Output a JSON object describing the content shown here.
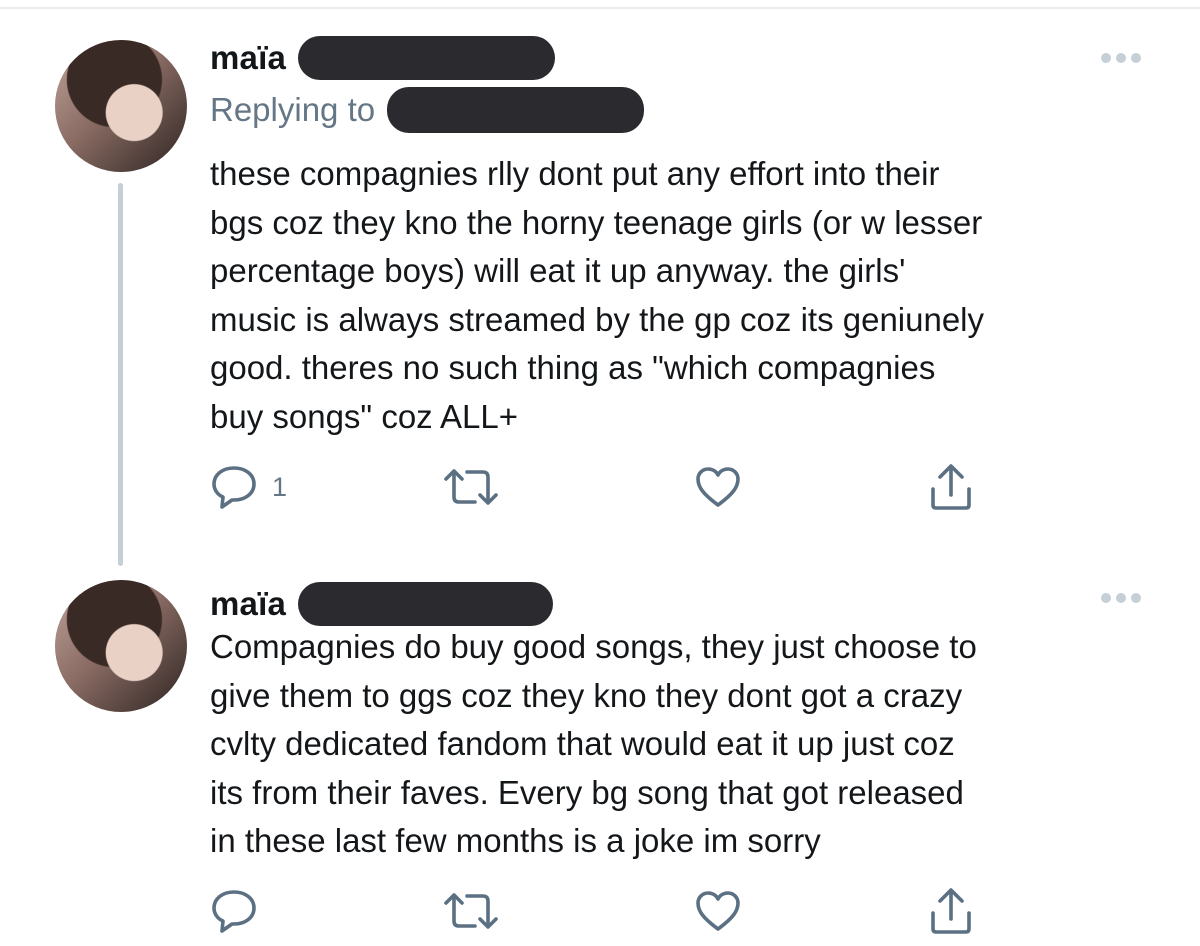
{
  "tweets": [
    {
      "display_name": "maïa",
      "handle_redacted": true,
      "replying_label": "Replying to",
      "reply_target_redacted": true,
      "text": "these compagnies rlly dont put any effort into their\nbgs coz they kno the horny teenage girls (or w lesser\npercentage boys) will eat it up anyway. the girls'\nmusic is always streamed by the gp coz its geniunely\ngood. theres no such thing as \"which compagnies\nbuy songs\" coz ALL+",
      "reply_count": "1",
      "actions": [
        "reply-icon",
        "retweet-icon",
        "like-icon",
        "share-icon"
      ]
    },
    {
      "display_name": "maïa",
      "handle_redacted": true,
      "text": "Compagnies do buy good songs, they just choose to\ngive them to ggs coz they kno they dont got a crazy\ncvlty dedicated fandom that would eat it up just coz\nits from their faves. Every bg song that got released\nin these last few months is a joke im sorry",
      "reply_count": "",
      "actions": [
        "reply-icon",
        "retweet-icon",
        "like-icon",
        "share-icon"
      ]
    }
  ],
  "colors": {
    "text": "#14171a",
    "secondary": "#657786",
    "icon": "#5b7083",
    "thread_line": "#c4cfd6",
    "redaction": "#2b2b2f"
  }
}
